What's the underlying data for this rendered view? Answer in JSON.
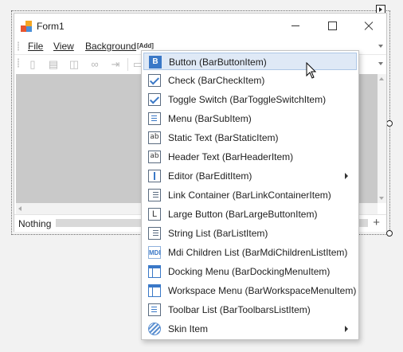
{
  "window": {
    "title": "Form1"
  },
  "menubar": {
    "items": [
      {
        "label": "File"
      },
      {
        "label": "View"
      },
      {
        "label": "Background"
      }
    ],
    "add_label": "[Add]"
  },
  "toolbar": {
    "icons": [
      "new-file-icon",
      "clipboard-icon",
      "layout-icon",
      "binoculars-icon",
      "insert-icon",
      "edit-icon"
    ]
  },
  "statusbar": {
    "text": "Nothing",
    "add_symbol": "+"
  },
  "popup_menu": {
    "items": [
      {
        "label": "Button (BarButtonItem)",
        "icon": "button-icon",
        "icon_text": "B",
        "highlighted": true
      },
      {
        "label": "Check (BarCheckItem)",
        "icon": "check-icon"
      },
      {
        "label": "Toggle Switch (BarToggleSwitchItem)",
        "icon": "toggle-check-icon"
      },
      {
        "label": "Menu (BarSubItem)",
        "icon": "menu-icon"
      },
      {
        "label": "Static Text (BarStaticItem)",
        "icon": "static-text-icon",
        "icon_text": "ab"
      },
      {
        "label": "Header Text (BarHeaderItem)",
        "icon": "header-text-icon",
        "icon_text": "ab"
      },
      {
        "label": "Editor (BarEditItem)",
        "icon": "editor-icon",
        "submenu": true
      },
      {
        "label": "Link Container (BarLinkContainerItem)",
        "icon": "link-container-icon"
      },
      {
        "label": "Large Button (BarLargeButtonItem)",
        "icon": "large-button-icon",
        "icon_text": "L"
      },
      {
        "label": "String List (BarListItem)",
        "icon": "string-list-icon"
      },
      {
        "label": "Mdi Children List (BarMdiChildrenListItem)",
        "icon": "mdi-icon",
        "icon_text": "MDI"
      },
      {
        "label": "Docking Menu (BarDockingMenuItem)",
        "icon": "docking-menu-icon"
      },
      {
        "label": "Workspace Menu (BarWorkspaceMenuItem)",
        "icon": "workspace-menu-icon"
      },
      {
        "label": "Toolbar List (BarToolbarsListItem)",
        "icon": "toolbar-list-icon"
      },
      {
        "label": "Skin Item",
        "icon": "skin-icon",
        "submenu": true
      }
    ]
  },
  "colors": {
    "accent": "#3a78c7",
    "highlight": "#dfe9f6",
    "client_area": "#c9c9c9"
  }
}
